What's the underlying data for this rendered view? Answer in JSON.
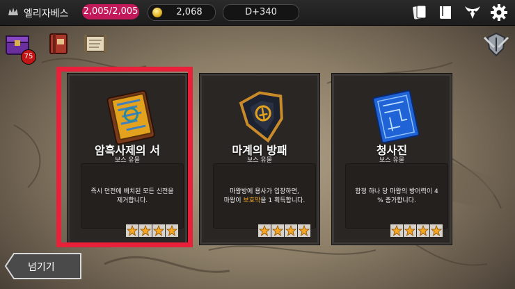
{
  "topbar": {
    "player_name": "엘리자베스",
    "hp": "2,005/2,005",
    "gold": "2,068",
    "day": "D+340"
  },
  "shortcuts": {
    "chest_badge_count": "75"
  },
  "cards": [
    {
      "title": "암흑사제의 서",
      "subtitle": "보스 유물",
      "desc_line1": "즉시 던전에 배치된 모든 신전을",
      "desc_line2": "제거합니다.",
      "stars": 4,
      "selected": true
    },
    {
      "title": "마계의 방패",
      "subtitle": "보스 유물",
      "desc_line1": "마왕방에 용사가 입장하면,",
      "desc_line2_pre": "마왕이 ",
      "desc_line2_hl": "보호막",
      "desc_line2_post": "을 1 획득합니다.",
      "stars": 4,
      "selected": false
    },
    {
      "title": "청사진",
      "subtitle": "보스 유물",
      "desc_line1": "함정 하나 당 마왕의 방어력이 4",
      "desc_line2": "% 증가합니다.",
      "stars": 4,
      "selected": false
    }
  ],
  "skip_button": {
    "label": "넘기기"
  },
  "colors": {
    "highlight": "#e8203a",
    "hp_badge": "#c2195b",
    "keyword": "#f5a623"
  }
}
